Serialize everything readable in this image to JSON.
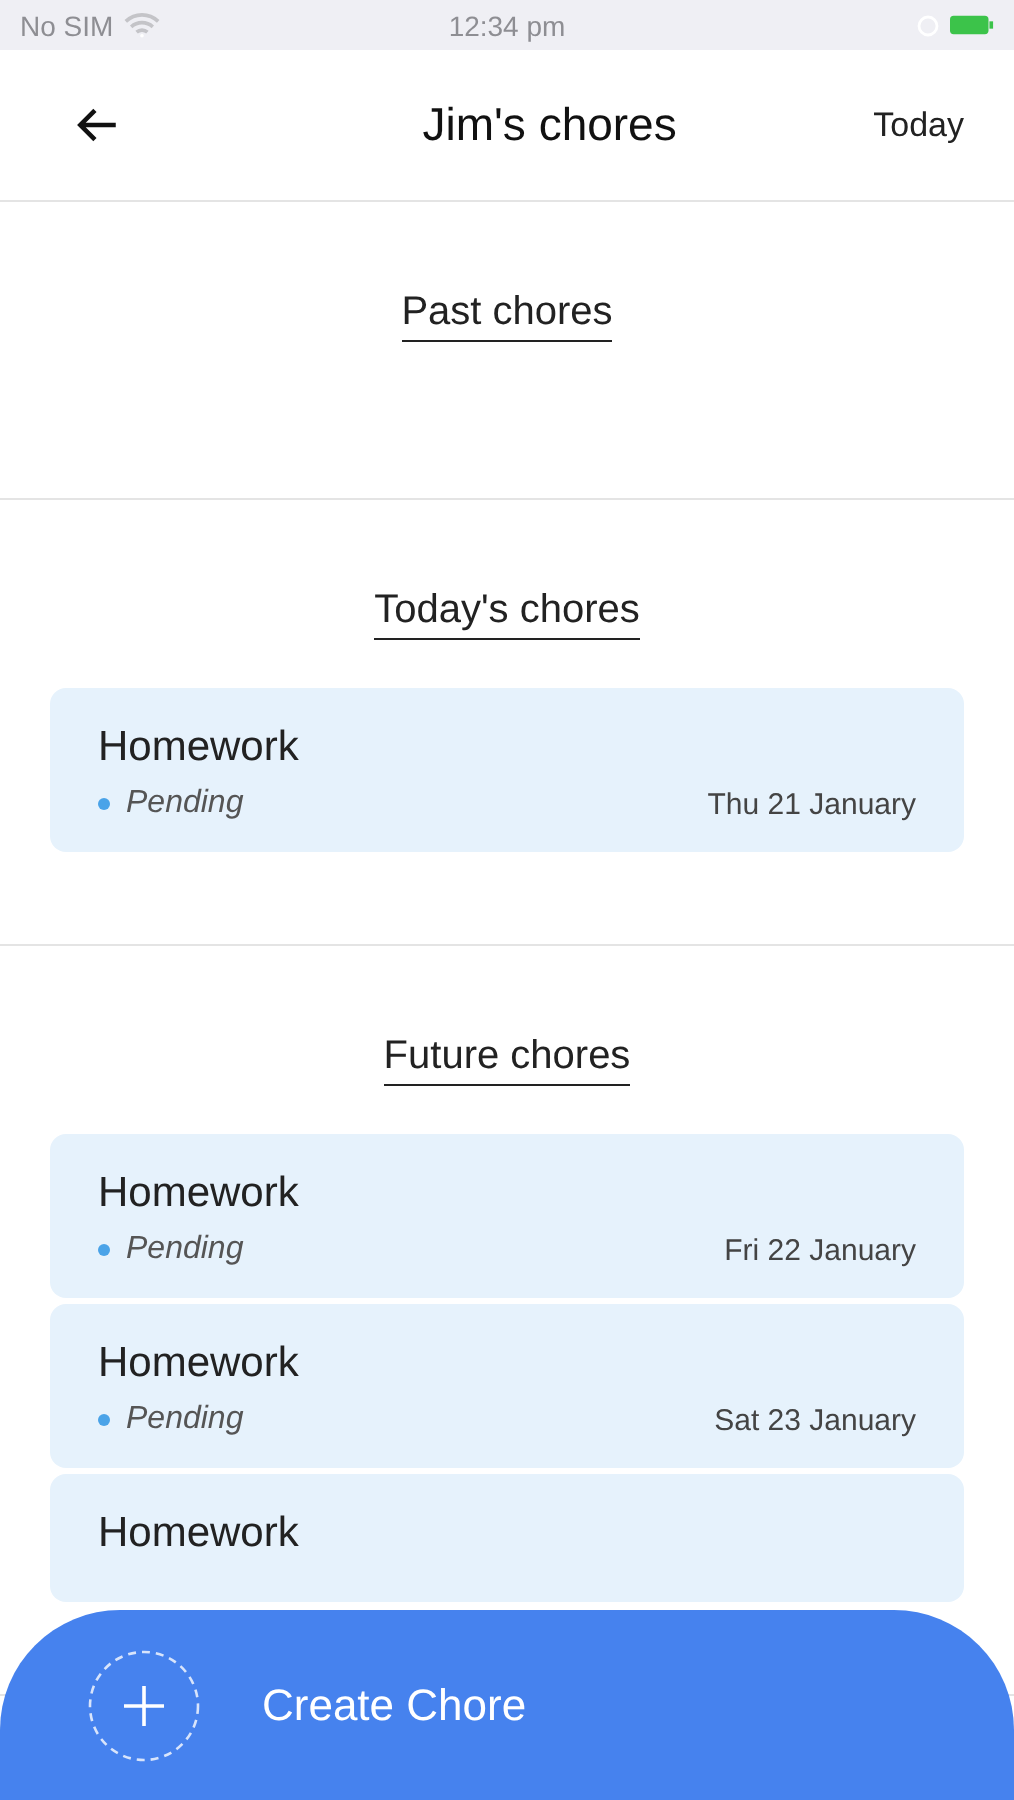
{
  "status_bar": {
    "carrier": "No SIM",
    "time": "12:34 pm"
  },
  "header": {
    "title": "Jim's chores",
    "action": "Today"
  },
  "sections": [
    {
      "title": "Past chores"
    },
    {
      "title": "Today's chores",
      "chores": [
        {
          "name": "Homework",
          "status": "Pending",
          "date": "Thu 21 January"
        }
      ]
    },
    {
      "title": "Future chores",
      "chores": [
        {
          "name": "Homework",
          "status": "Pending",
          "date": "Fri 22 January"
        },
        {
          "name": "Homework",
          "status": "Pending",
          "date": "Sat 23 January"
        },
        {
          "name": "Homework"
        }
      ]
    }
  ],
  "create_button": {
    "label": "Create Chore"
  }
}
